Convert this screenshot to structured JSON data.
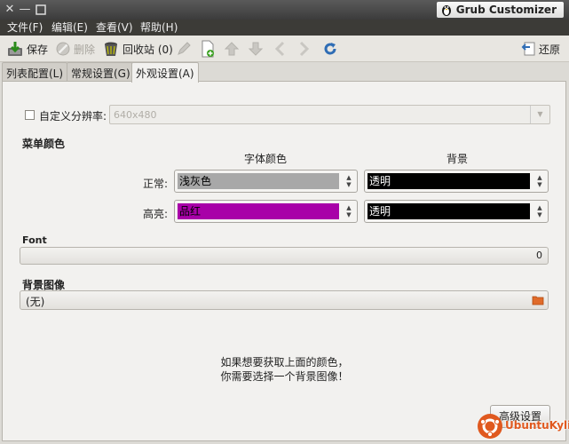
{
  "window": {
    "title": "Grub Customizer"
  },
  "menu": [
    "文件(F)",
    "编辑(E)",
    "查看(V)",
    "帮助(H)"
  ],
  "toolbar": {
    "save": "保存",
    "delete": "删除",
    "recycle": "回收站 (0)",
    "revert": "还原"
  },
  "tabs": [
    "列表配置(L)",
    "常规设置(G)",
    "外观设置(A)"
  ],
  "active_tab": 2,
  "resolution": {
    "checkbox_label": "自定义分辨率:",
    "checked": false,
    "value": "640x480"
  },
  "menu_colors": {
    "section_title": "菜单颜色",
    "col_font": "字体颜色",
    "col_background": "背景",
    "normal_label": "正常:",
    "highlight_label": "高亮:",
    "normal_font": "浅灰色",
    "normal_bg": "透明",
    "highlight_font": "品红",
    "highlight_bg": "透明",
    "colors": {
      "light_gray": "#a8a8a8",
      "magenta": "#a800a8",
      "transparent_bg": "#000000"
    }
  },
  "font": {
    "section_title": "Font",
    "size": "0"
  },
  "background_image": {
    "section_title": "背景图像",
    "value": "(无)"
  },
  "hint": {
    "line1": "如果想要获取上面的颜色，",
    "line2": "你需要选择一个背景图像！"
  },
  "advanced_button": "高级设置",
  "watermark": "UbuntuKylin"
}
